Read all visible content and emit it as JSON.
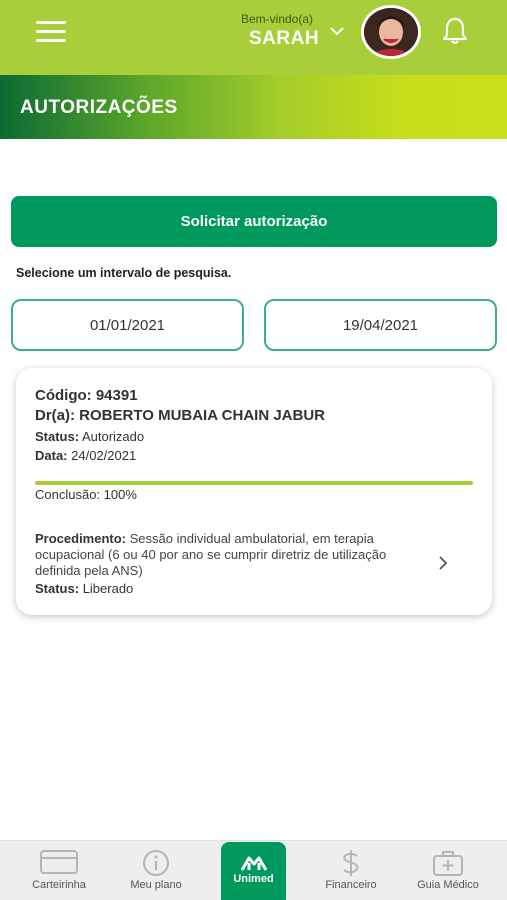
{
  "header": {
    "welcome": "Bem-vindo(a)",
    "user_name": "SARAH",
    "title": "AUTORIZAÇÕES"
  },
  "actions": {
    "request_label": "Solicitar autorização"
  },
  "filter": {
    "label": "Selecione um intervalo de pesquisa.",
    "start_date": "01/01/2021",
    "end_date": "19/04/2021"
  },
  "authorization": {
    "code_label": "Código:",
    "code": "94391",
    "doctor_label": "Dr(a):",
    "doctor": "ROBERTO MUBAIA CHAIN JABUR",
    "status_label": "Status:",
    "status": "Autorizado",
    "date_label": "Data:",
    "date": "24/02/2021",
    "conclusion_label": "Conclusão:",
    "conclusion": "100%",
    "progress": 1.0,
    "procedure_label": "Procedimento:",
    "procedure": "Sessão individual ambulatorial, em terapia ocupacional (6 ou 40 por ano se cumprir diretriz de utilização definida pela ANS)",
    "procedure_status_label": "Status:",
    "procedure_status": "Liberado"
  },
  "bottom_nav": {
    "items": [
      {
        "label": "Carteirinha",
        "icon": "card-icon"
      },
      {
        "label": "Meu plano",
        "icon": "info-icon"
      },
      {
        "label": "Unimed",
        "icon": "unimed-logo-icon"
      },
      {
        "label": "Financeiro",
        "icon": "dollar-icon"
      },
      {
        "label": "Guia Médico",
        "icon": "medical-kit-icon"
      }
    ]
  },
  "colors": {
    "header_bg": "#a8ce3a",
    "primary": "#00995d",
    "border_green": "#3fb07a",
    "progress": "#a9cb3c"
  }
}
